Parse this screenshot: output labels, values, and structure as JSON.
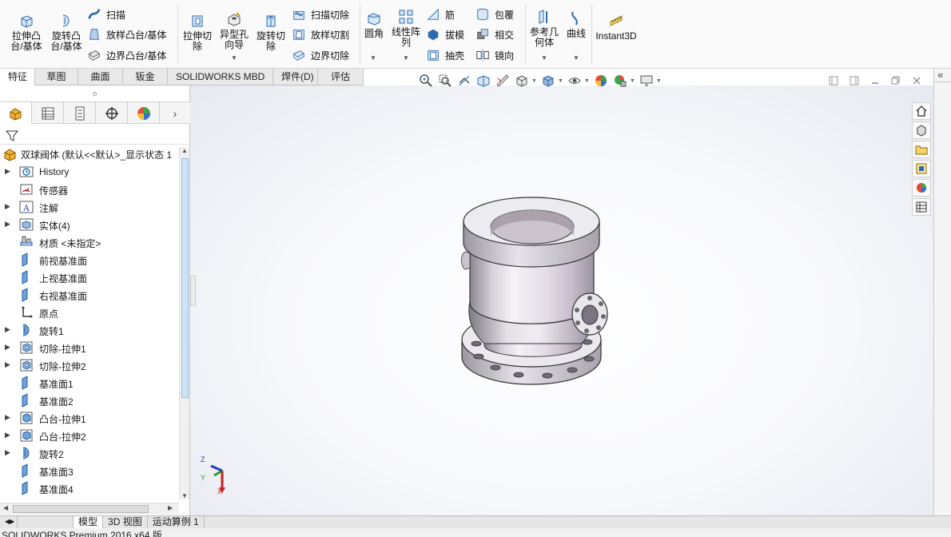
{
  "ribbon": {
    "extrude_boss": "拉伸凸\n台/基体",
    "revolve_boss": "旋转凸\n台/基体",
    "sweep": "扫描",
    "loft": "放样凸台/基体",
    "boundary_boss": "边界凸台/基体",
    "extrude_cut": "拉伸切\n除",
    "hole_wizard": "异型孔\n向导",
    "revolve_cut": "旋转切\n除",
    "swept_cut": "扫描切除",
    "lofted_cut": "放样切割",
    "boundary_cut": "边界切除",
    "fillet": "圆角",
    "linear_pattern": "线性阵\n列",
    "rib": "筋",
    "draft": "拔模",
    "shell": "抽壳",
    "wrap": "包覆",
    "intersect": "相交",
    "mirror": "镜向",
    "ref_geometry": "参考几\n何体",
    "curves": "曲线",
    "instant3d": "Instant3D"
  },
  "command_tabs": [
    "特征",
    "草图",
    "曲面",
    "钣金",
    "SOLIDWORKS MBD",
    "焊件(D)",
    "评估"
  ],
  "active_command_tab": 0,
  "feature_tree": {
    "root": "双球阀体 (默认<<默认>_显示状态 1",
    "items": [
      {
        "label": "History",
        "icon": "history-icon",
        "expandable": true
      },
      {
        "label": "传感器",
        "icon": "sensor-icon",
        "expandable": false
      },
      {
        "label": "注解",
        "icon": "annotation-icon",
        "expandable": true
      },
      {
        "label": "实体(4)",
        "icon": "solid-bodies-icon",
        "expandable": true
      },
      {
        "label": "材质 <未指定>",
        "icon": "material-icon",
        "expandable": false
      },
      {
        "label": "前视基准面",
        "icon": "plane-icon",
        "expandable": false
      },
      {
        "label": "上视基准面",
        "icon": "plane-icon",
        "expandable": false
      },
      {
        "label": "右视基准面",
        "icon": "plane-icon",
        "expandable": false
      },
      {
        "label": "原点",
        "icon": "origin-icon",
        "expandable": false
      },
      {
        "label": "旋转1",
        "icon": "revolve-feature-icon",
        "expandable": true
      },
      {
        "label": "切除-拉伸1",
        "icon": "cut-extrude-feature-icon",
        "expandable": true
      },
      {
        "label": "切除-拉伸2",
        "icon": "cut-extrude-feature-icon",
        "expandable": true
      },
      {
        "label": "基准面1",
        "icon": "plane-icon",
        "expandable": false
      },
      {
        "label": "基准面2",
        "icon": "plane-icon",
        "expandable": false
      },
      {
        "label": "凸台-拉伸1",
        "icon": "boss-extrude-feature-icon",
        "expandable": true
      },
      {
        "label": "凸台-拉伸2",
        "icon": "boss-extrude-feature-icon",
        "expandable": true
      },
      {
        "label": "旋转2",
        "icon": "revolve-feature-icon",
        "expandable": true
      },
      {
        "label": "基准面3",
        "icon": "plane-icon",
        "expandable": false
      },
      {
        "label": "基准面4",
        "icon": "plane-icon",
        "expandable": false
      }
    ]
  },
  "triad": {
    "x": "X",
    "y": "Y",
    "z": "Z"
  },
  "bottom_tabs": [
    "模型",
    "3D 视图",
    "运动算例 1"
  ],
  "active_bottom_tab": 0,
  "status": "SOLIDWORKS Premium 2016 x64 版",
  "colors": {
    "accent": "#1f6fc4",
    "ribbon_bg": "#fafafa",
    "tab_bg": "#e9e9e9",
    "part": "#d8d5dc",
    "axis_x": "#c81e1e",
    "axis_y": "#2a9a2a",
    "axis_z": "#1f3fb8"
  }
}
